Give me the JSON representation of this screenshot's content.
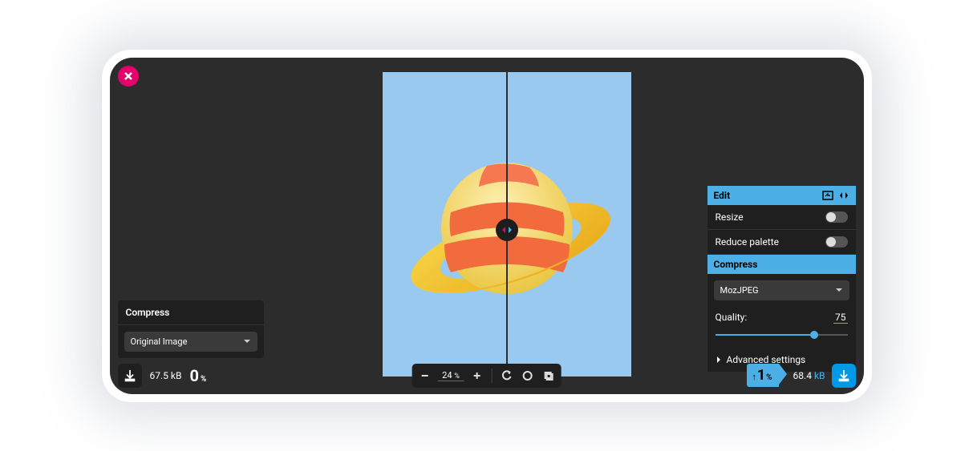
{
  "close_label": "Close",
  "left": {
    "header": "Compress",
    "format_select": "Original Image",
    "file_size_value": "67.5",
    "file_size_unit": "kB",
    "percent_value": "0",
    "percent_unit": "%"
  },
  "toolbar": {
    "zoom_value": "24",
    "zoom_unit": "%"
  },
  "right": {
    "edit_header": "Edit",
    "resize_label": "Resize",
    "palette_label": "Reduce palette",
    "compress_header": "Compress",
    "encoder_select": "MozJPEG",
    "quality_label": "Quality:",
    "quality_value": "75",
    "advanced_label": "Advanced settings",
    "delta_percent": "1",
    "delta_unit": "%",
    "file_size_value": "68.4",
    "file_size_unit": "kB"
  },
  "colors": {
    "accent": "#4cb0e6",
    "close": "#e6006b",
    "download": "#0099e6"
  }
}
